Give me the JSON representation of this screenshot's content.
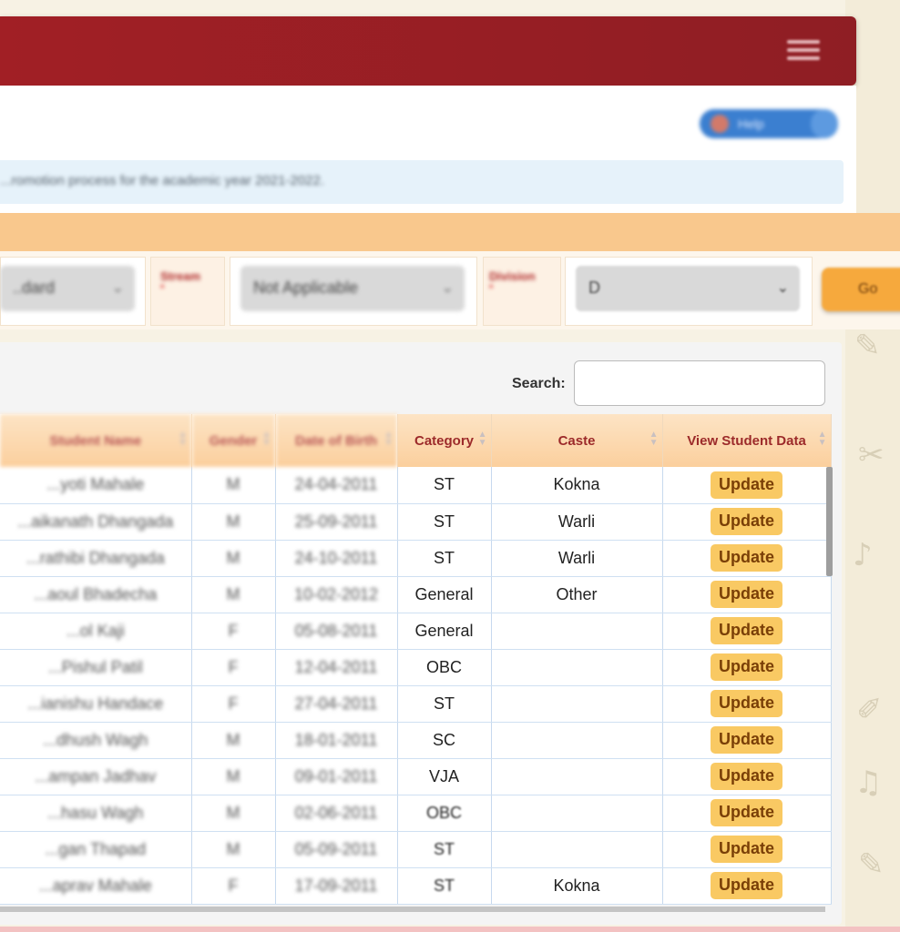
{
  "header": {
    "menu_icon": "hamburger-icon"
  },
  "help": {
    "label": "Help",
    "icon": "info-icon"
  },
  "notice": {
    "text": "...romotion process for the academic year 2021-2022."
  },
  "filters": {
    "standard": {
      "value": "..dard"
    },
    "stream": {
      "label": "Stream",
      "required": "*",
      "value": "Not Applicable"
    },
    "division": {
      "label": "Division",
      "required": "*",
      "value": "D"
    },
    "go_label": "Go"
  },
  "search": {
    "label": "Search:",
    "placeholder": ""
  },
  "table": {
    "headers": [
      "Student Name",
      "Gender",
      "Date of Birth",
      "Category",
      "Caste",
      "View Student Data"
    ],
    "action_label": "Update",
    "rows": [
      {
        "name": "...yoti Mahale",
        "gender": "M",
        "dob": "24-04-2011",
        "category": "ST",
        "caste": "Kokna"
      },
      {
        "name": "...aikanath Dhangada",
        "gender": "M",
        "dob": "25-09-2011",
        "category": "ST",
        "caste": "Warli"
      },
      {
        "name": "...rathibi Dhangada",
        "gender": "M",
        "dob": "24-10-2011",
        "category": "ST",
        "caste": "Warli"
      },
      {
        "name": "...aoul Bhadecha",
        "gender": "M",
        "dob": "10-02-2012",
        "category": "General",
        "caste": "Other"
      },
      {
        "name": "...ol Kaji",
        "gender": "F",
        "dob": "05-08-2011",
        "category": "General",
        "caste": ""
      },
      {
        "name": "...Pishul Patil",
        "gender": "F",
        "dob": "12-04-2011",
        "category": "OBC",
        "caste": ""
      },
      {
        "name": "...ianishu Handace",
        "gender": "F",
        "dob": "27-04-2011",
        "category": "ST",
        "caste": ""
      },
      {
        "name": "...dhush Wagh",
        "gender": "M",
        "dob": "18-01-2011",
        "category": "SC",
        "caste": ""
      },
      {
        "name": "...ampan Jadhav",
        "gender": "M",
        "dob": "09-01-2011",
        "category": "VJA",
        "caste": ""
      },
      {
        "name": "...hasu Wagh",
        "gender": "M",
        "dob": "02-06-2011",
        "category": "OBC",
        "caste": ""
      },
      {
        "name": "...gan Thapad",
        "gender": "M",
        "dob": "05-09-2011",
        "category": "ST",
        "caste": ""
      },
      {
        "name": "...aprav Mahale",
        "gender": "F",
        "dob": "17-09-2011",
        "category": "ST",
        "caste": "Kokna"
      }
    ]
  },
  "colors": {
    "header": "#a11f25",
    "band": "#f9c88d",
    "update_button": "#f9c963",
    "th_text": "#9c2a2a"
  }
}
